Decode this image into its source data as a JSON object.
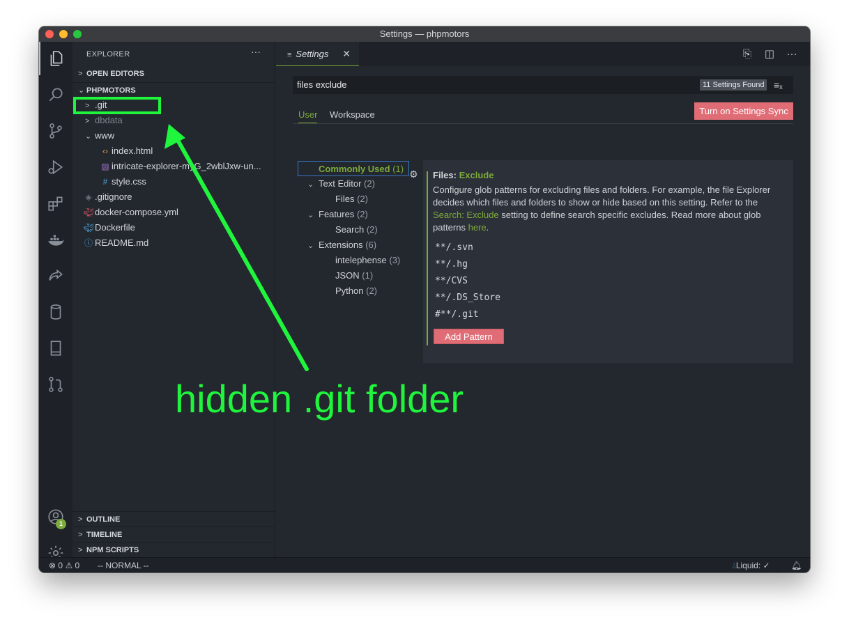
{
  "window": {
    "title": "Settings — phpmotors"
  },
  "activity_bar": {
    "items": [
      {
        "name": "explorer-icon"
      },
      {
        "name": "search-icon"
      },
      {
        "name": "source-control-icon"
      },
      {
        "name": "run-debug-icon"
      },
      {
        "name": "extensions-icon"
      },
      {
        "name": "docker-icon"
      },
      {
        "name": "live-share-icon"
      },
      {
        "name": "database-icon"
      },
      {
        "name": "book-icon"
      },
      {
        "name": "pull-request-icon"
      }
    ],
    "accounts_badge": "1"
  },
  "sidebar": {
    "title": "EXPLORER",
    "more": "···",
    "open_editors": "OPEN EDITORS",
    "project": "PHPMOTORS",
    "tree": [
      {
        "label": ".git",
        "icon": "chevron-right"
      },
      {
        "label": "dbdata",
        "icon": "chevron-right"
      },
      {
        "label": "www",
        "icon": "chevron-down"
      },
      {
        "label": "index.html",
        "icon": "<>"
      },
      {
        "label": "intricate-explorer-myG_2wblJxw-un...",
        "icon": "image"
      },
      {
        "label": "style.css",
        "icon": "#"
      },
      {
        "label": ".gitignore",
        "icon": "diamond"
      },
      {
        "label": "docker-compose.yml",
        "icon": "docker"
      },
      {
        "label": "Dockerfile",
        "icon": "docker"
      },
      {
        "label": "README.md",
        "icon": "info"
      }
    ],
    "outline": "OUTLINE",
    "timeline": "TIMELINE",
    "npm_scripts": "NPM SCRIPTS"
  },
  "editor": {
    "tab_label": "Settings",
    "tab_close": "✕"
  },
  "settings": {
    "search_value": "files exclude",
    "found_badge": "11 Settings Found",
    "tab_user": "User",
    "tab_workspace": "Workspace",
    "sync_button": "Turn on Settings Sync",
    "toc": [
      {
        "label": "Commonly Used",
        "count": "(1)"
      },
      {
        "label": "Text Editor",
        "count": "(2)"
      },
      {
        "label": "Files",
        "count": "(2)"
      },
      {
        "label": "Features",
        "count": "(2)"
      },
      {
        "label": "Search",
        "count": "(2)"
      },
      {
        "label": "Extensions",
        "count": "(6)"
      },
      {
        "label": "intelephense",
        "count": "(3)"
      },
      {
        "label": "JSON",
        "count": "(1)"
      },
      {
        "label": "Python",
        "count": "(2)"
      }
    ],
    "setting": {
      "category": "Files:",
      "name": "Exclude",
      "desc_1": "Configure glob patterns for excluding files and folders. For example, the file Explorer decides which files and folders to show or hide based on this setting. Refer to the ",
      "desc_link": "Search: Exclude",
      "desc_2": " setting to define search specific excludes. Read more about glob patterns ",
      "desc_link_2": "here",
      "desc_3": ".",
      "patterns": [
        "**/.svn",
        "**/.hg",
        "**/CVS",
        "**/.DS_Store",
        "#**/.git"
      ],
      "add_button": "Add Pattern"
    }
  },
  "status_bar": {
    "errors": "0",
    "warnings": "0",
    "mode": "-- NORMAL --",
    "liquid": "Liquid: ✓"
  },
  "annotation": {
    "text": "hidden .git folder",
    "color": "#1ef53c"
  },
  "colors": {
    "accent_green": "#7cab3b",
    "sync_button": "#e06c75",
    "background": "#23272e"
  }
}
